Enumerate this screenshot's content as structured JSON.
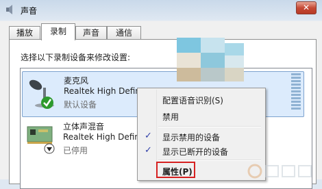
{
  "window": {
    "title": "声音",
    "close_label": "✕"
  },
  "tabs": [
    {
      "label": "播放"
    },
    {
      "label": "录制",
      "active": true
    },
    {
      "label": "声音"
    },
    {
      "label": "通信"
    }
  ],
  "panel": {
    "instruction": "选择以下录制设备来修改设置:"
  },
  "devices": [
    {
      "name": "麦克风",
      "driver": "Realtek High Defin",
      "status": "默认设备",
      "selected": true,
      "icon": "microphone-icon"
    },
    {
      "name": "立体声混音",
      "driver": "Realtek High Defin",
      "status": "已停用",
      "selected": false,
      "icon": "sound-card-icon"
    }
  ],
  "context_menu": {
    "items": [
      {
        "label": "配置语音识别(S)"
      },
      {
        "label": "禁用"
      },
      {
        "label": "显示禁用的设备",
        "checked": true
      },
      {
        "label": "显示已断开的设备",
        "checked": true
      },
      {
        "label": "属性(P)",
        "highlighted": true
      }
    ]
  },
  "colors": {
    "highlight_box": "#d62020",
    "selection": "#dcebfc",
    "check": "#2f3fa8"
  }
}
